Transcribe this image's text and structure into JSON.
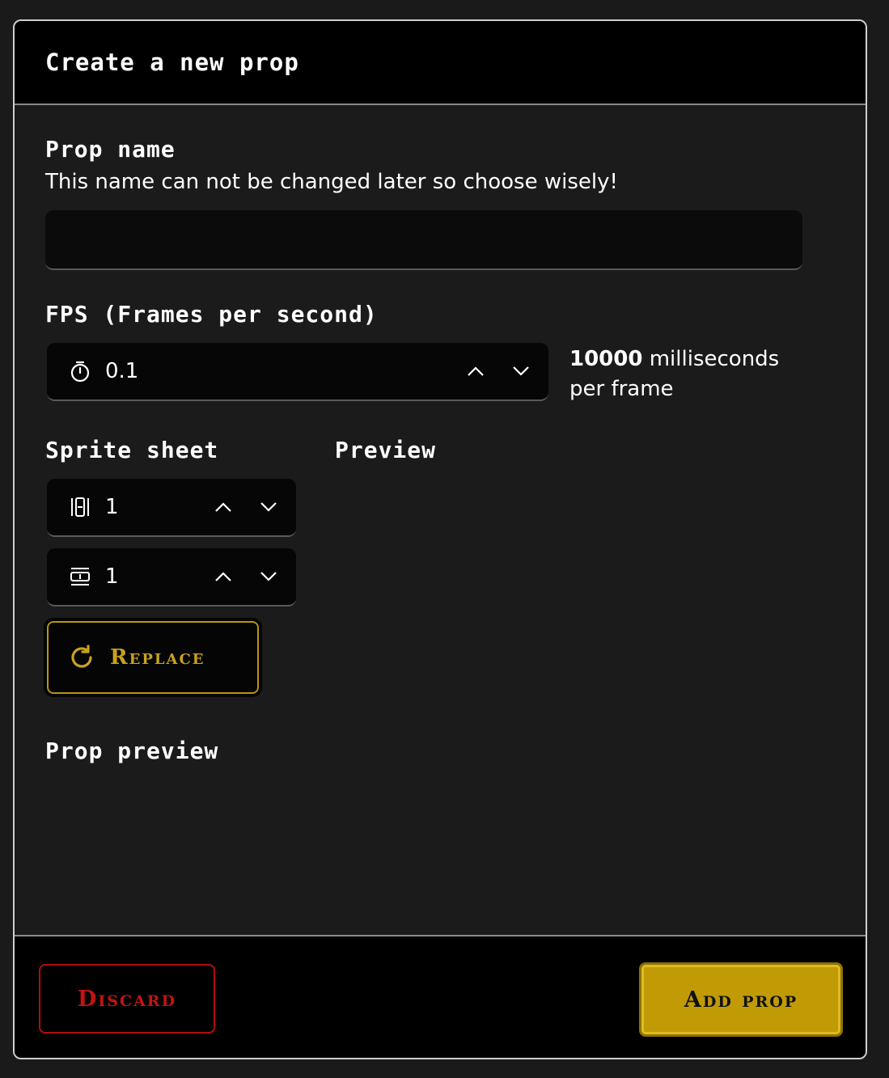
{
  "dialog": {
    "title": "Create a new prop"
  },
  "prop_name": {
    "label": "Prop name",
    "help": "This name can not be changed later so choose wisely!",
    "value": "",
    "placeholder": ""
  },
  "fps": {
    "label": "FPS (Frames per second)",
    "value": "0.1",
    "ms_value": "10000",
    "ms_suffix": "milliseconds",
    "ms_suffix2": "per frame"
  },
  "sprite_sheet": {
    "label": "Sprite sheet",
    "columns_value": "1",
    "rows_value": "1",
    "replace_label": "Replace"
  },
  "preview": {
    "label": "Preview"
  },
  "prop_preview": {
    "label": "Prop preview"
  },
  "footer": {
    "discard_label": "Discard",
    "add_label": "Add prop"
  },
  "colors": {
    "accent_gold": "#c19b06",
    "discard_red": "#c41212",
    "background": "#1b1b1b",
    "header_bg": "#000000"
  },
  "icons": {
    "fps": "stopwatch-icon",
    "columns": "columns-icon",
    "rows": "rows-icon",
    "replace": "refresh-icon",
    "increment": "chevron-up-icon",
    "decrement": "chevron-down-icon"
  }
}
